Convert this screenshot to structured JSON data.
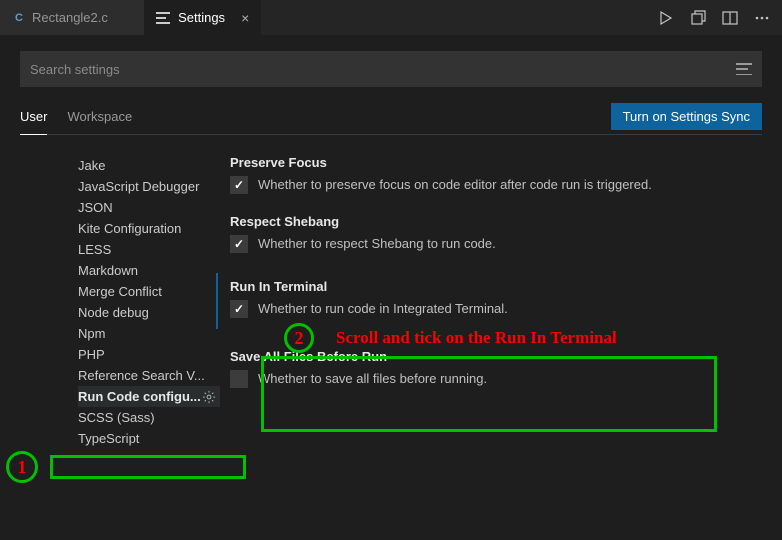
{
  "tabs": [
    {
      "label": "Rectangle2.c",
      "icon_letter": "C",
      "active": false
    },
    {
      "label": "Settings",
      "icon": "settings",
      "active": true
    }
  ],
  "search": {
    "placeholder": "Search settings"
  },
  "scope": {
    "tabs": [
      "User",
      "Workspace"
    ],
    "active": "User",
    "sync_button": "Turn on Settings Sync"
  },
  "sidebar": {
    "items": [
      "Jake",
      "JavaScript Debugger",
      "JSON",
      "Kite Configuration",
      "LESS",
      "Markdown",
      "Merge Conflict",
      "Node debug",
      "Npm",
      "PHP",
      "Reference Search V...",
      "Run Code configu...",
      "SCSS (Sass)",
      "TypeScript"
    ],
    "selected_index": 11
  },
  "settings": [
    {
      "key": "preserve_focus",
      "title": "Preserve Focus",
      "description": "Whether to preserve focus on code editor after code run is triggered.",
      "checked": true
    },
    {
      "key": "respect_shebang",
      "title": "Respect Shebang",
      "description": "Whether to respect Shebang to run code.",
      "checked": true
    },
    {
      "key": "run_in_terminal",
      "title": "Run In Terminal",
      "description": "Whether to run code in Integrated Terminal.",
      "checked": true,
      "highlighted": true
    },
    {
      "key": "save_all_before_run",
      "title": "Save All Files Before Run",
      "description": "Whether to save all files before running.",
      "checked": false
    }
  ],
  "annotations": {
    "step1": "1",
    "step2": "2",
    "instruction": "Scroll and tick on the Run In Terminal"
  }
}
